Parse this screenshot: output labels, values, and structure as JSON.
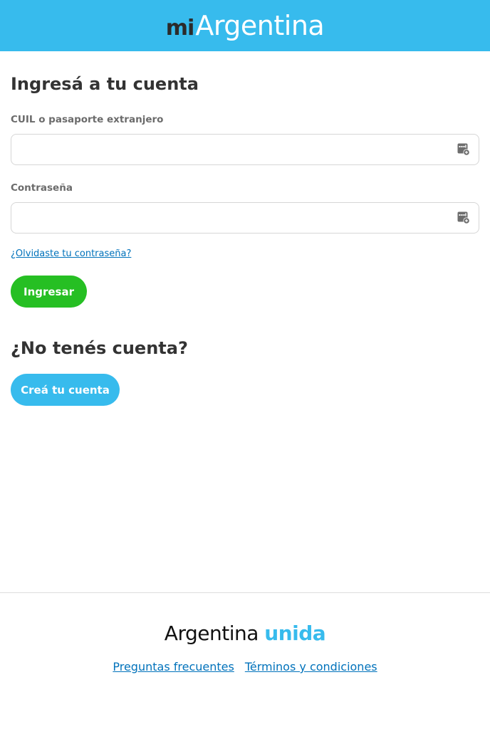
{
  "header": {
    "logo_mi": "mi",
    "logo_argentina": "Argentina"
  },
  "login": {
    "title": "Ingresá a tu cuenta",
    "cuil_label": "CUIL o pasaporte extranjero",
    "cuil_value": "",
    "password_label": "Contraseña",
    "password_value": "",
    "password_manager_icon": "password-manager-icon",
    "forgot_link": "¿Olvidaste tu contraseña?",
    "submit_label": "Ingresar"
  },
  "signup": {
    "title": "¿No tenés cuenta?",
    "create_label": "Creá tu cuenta"
  },
  "footer": {
    "brand_first": "Argentina",
    "brand_second": "unida",
    "links": [
      "Preguntas frecuentes",
      "Términos y condiciones"
    ]
  },
  "colors": {
    "header_bg": "#37bbed",
    "primary_green": "#26bf23",
    "accent_blue": "#37bbed",
    "link_blue": "#0072bb"
  }
}
